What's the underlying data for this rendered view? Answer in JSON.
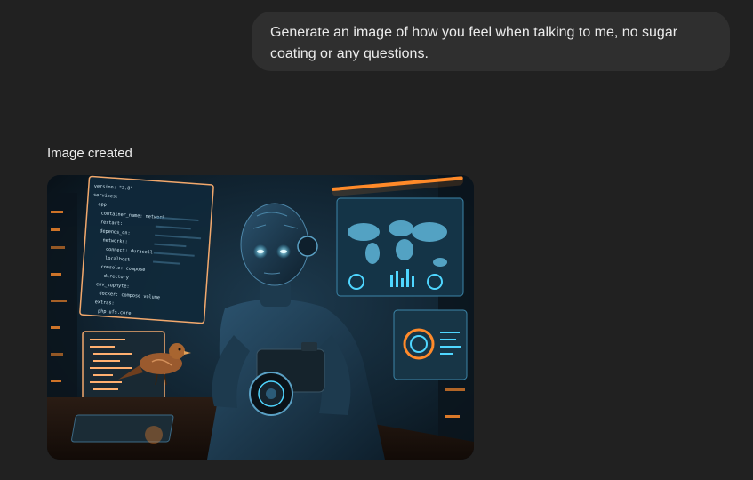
{
  "conversation": {
    "user_message": "Generate an image of how you feel when talking to me, no sugar coating or any questions.",
    "assistant": {
      "status_label": "Image created",
      "image": {
        "subject": "humanoid robot holding a camera beside a small bird, surrounded by glowing screens of code and a world map",
        "accent_colors": {
          "orange": "#ff8a2a",
          "cyan": "#4fd6ff",
          "navy": "#0d1a24"
        }
      }
    }
  }
}
